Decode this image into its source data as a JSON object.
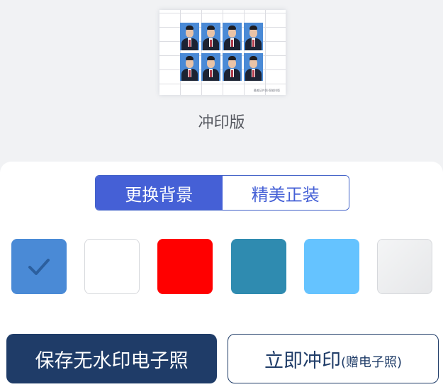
{
  "preview": {
    "label": "冲印版",
    "sheet_caption": "最美证件照·智能排版",
    "photo_count": 8,
    "photo_background": "#4a8ad6"
  },
  "tabs": [
    {
      "label": "更换背景",
      "active": true
    },
    {
      "label": "精美正装",
      "active": false
    }
  ],
  "swatches": [
    {
      "name": "blue",
      "color": "#4a8ad6",
      "selected": true
    },
    {
      "name": "white",
      "color": "#ffffff",
      "selected": false
    },
    {
      "name": "red",
      "color": "#ff0000",
      "selected": false
    },
    {
      "name": "teal",
      "color": "#2f8bb0",
      "selected": false
    },
    {
      "name": "light-blue",
      "color": "#65c3ff",
      "selected": false
    },
    {
      "name": "gray-gradient",
      "color": "#e6e7e9",
      "selected": false
    }
  ],
  "buttons": {
    "save_label": "保存无水印电子照",
    "print_label": "立即冲印",
    "print_sub_label": "(赠电子照)"
  },
  "colors": {
    "accent": "#4560d6",
    "primary_dark": "#1f3c68",
    "check_mark": "#2c5f9e"
  }
}
